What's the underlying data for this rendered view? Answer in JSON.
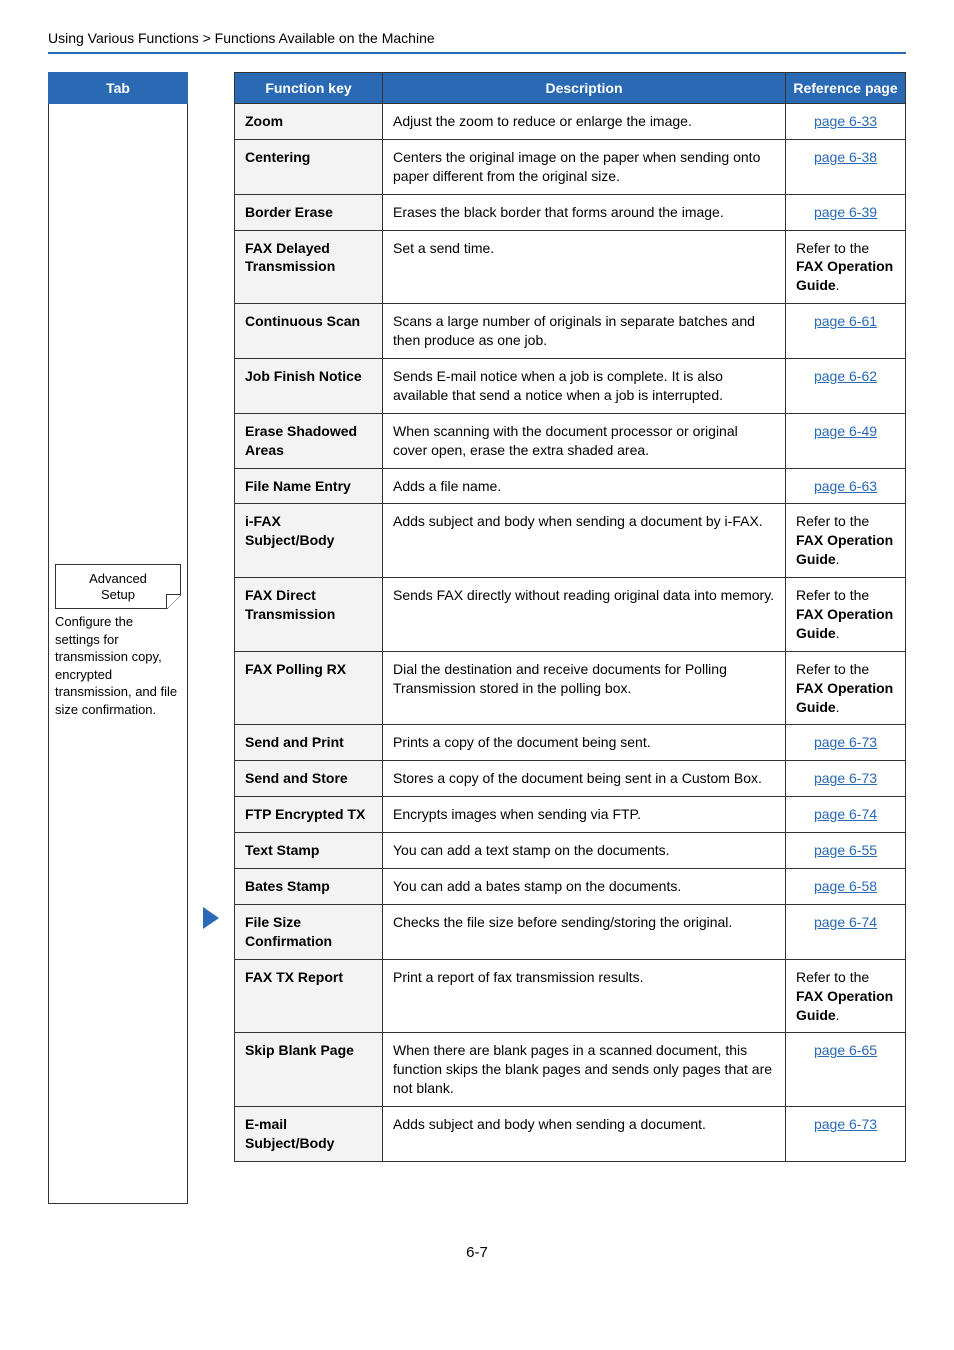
{
  "breadcrumb": "Using Various Functions > Functions Available on the Machine",
  "page_number": "6-7",
  "left": {
    "header": "Tab",
    "box_line1": "Advanced",
    "box_line2": "Setup",
    "desc": "Configure the settings for transmission copy, encrypted transmission, and file size confirmation."
  },
  "table": {
    "head": {
      "fn": "Function key",
      "desc": "Description",
      "ref": "Reference page"
    },
    "rows": [
      {
        "fn": "Zoom",
        "desc": "Adjust the zoom to reduce or enlarge the image.",
        "ref_type": "link",
        "ref": "page 6-33"
      },
      {
        "fn": "Centering",
        "desc": "Centers the original image on the paper when sending onto paper different from the original size.",
        "ref_type": "link",
        "ref": "page 6-38"
      },
      {
        "fn": "Border Erase",
        "desc": "Erases the black border that forms around the image.",
        "ref_type": "link",
        "ref": "page 6-39"
      },
      {
        "fn": "FAX Delayed Transmission",
        "desc": "Set a send time.",
        "ref_type": "guide",
        "ref_pre": "Refer to the ",
        "ref_bold": "FAX Operation Guide",
        "ref_post": "."
      },
      {
        "fn": "Continuous Scan",
        "desc": "Scans a large number of originals in separate batches and then produce as one job.",
        "ref_type": "link",
        "ref": "page 6-61"
      },
      {
        "fn": "Job Finish Notice",
        "desc": "Sends E-mail notice when a job is complete. It is also available that send a notice when a job is interrupted.",
        "ref_type": "link",
        "ref": "page 6-62"
      },
      {
        "fn": "Erase Shadowed Areas",
        "desc": "When scanning with the document processor or original cover open, erase the extra shaded area.",
        "ref_type": "link",
        "ref": "page 6-49"
      },
      {
        "fn": "File Name Entry",
        "desc": "Adds a file name.",
        "ref_type": "link",
        "ref": "page 6-63"
      },
      {
        "fn": "i-FAX Subject/Body",
        "desc": "Adds subject and body when sending a document by i-FAX.",
        "ref_type": "guide",
        "ref_pre": "Refer to the ",
        "ref_bold": "FAX Operation Guide",
        "ref_post": "."
      },
      {
        "fn": "FAX Direct Transmission",
        "desc": "Sends FAX directly without reading original data into memory.",
        "ref_type": "guide",
        "ref_pre": "Refer to the ",
        "ref_bold": "FAX Operation Guide",
        "ref_post": "."
      },
      {
        "fn": "FAX Polling RX",
        "desc": "Dial the destination and receive documents for Polling Transmission stored in the polling box.",
        "ref_type": "guide",
        "ref_pre": "Refer to the ",
        "ref_bold": "FAX Operation Guide",
        "ref_post": "."
      },
      {
        "fn": "Send and Print",
        "desc": "Prints a copy of the document being sent.",
        "ref_type": "link",
        "ref": "page 6-73"
      },
      {
        "fn": "Send and Store",
        "desc": "Stores a copy of the document being sent in a Custom Box.",
        "ref_type": "link",
        "ref": "page 6-73"
      },
      {
        "fn": "FTP Encrypted TX",
        "desc": "Encrypts images when sending via FTP.",
        "ref_type": "link",
        "ref": "page 6-74"
      },
      {
        "fn": "Text Stamp",
        "desc": "You can add a text stamp on the documents.",
        "ref_type": "link",
        "ref": "page 6-55"
      },
      {
        "fn": "Bates Stamp",
        "desc": "You can add a bates stamp on the documents.",
        "ref_type": "link",
        "ref": "page 6-58"
      },
      {
        "fn": "File Size Confirmation",
        "desc": "Checks the file size before sending/storing the original.",
        "ref_type": "link",
        "ref": "page 6-74"
      },
      {
        "fn": "FAX TX Report",
        "desc": "Print a report of fax transmission results.",
        "ref_type": "guide",
        "ref_pre": "Refer to the ",
        "ref_bold": "FAX Operation Guide",
        "ref_post": "."
      },
      {
        "fn": "Skip Blank Page",
        "desc": "When there are blank pages in a scanned document, this function skips the blank pages and sends only pages that are not blank.",
        "ref_type": "link",
        "ref": "page 6-65"
      },
      {
        "fn": "E-mail Subject/Body",
        "desc": "Adds subject and body when sending a document.",
        "ref_type": "link",
        "ref": "page 6-73"
      }
    ]
  }
}
